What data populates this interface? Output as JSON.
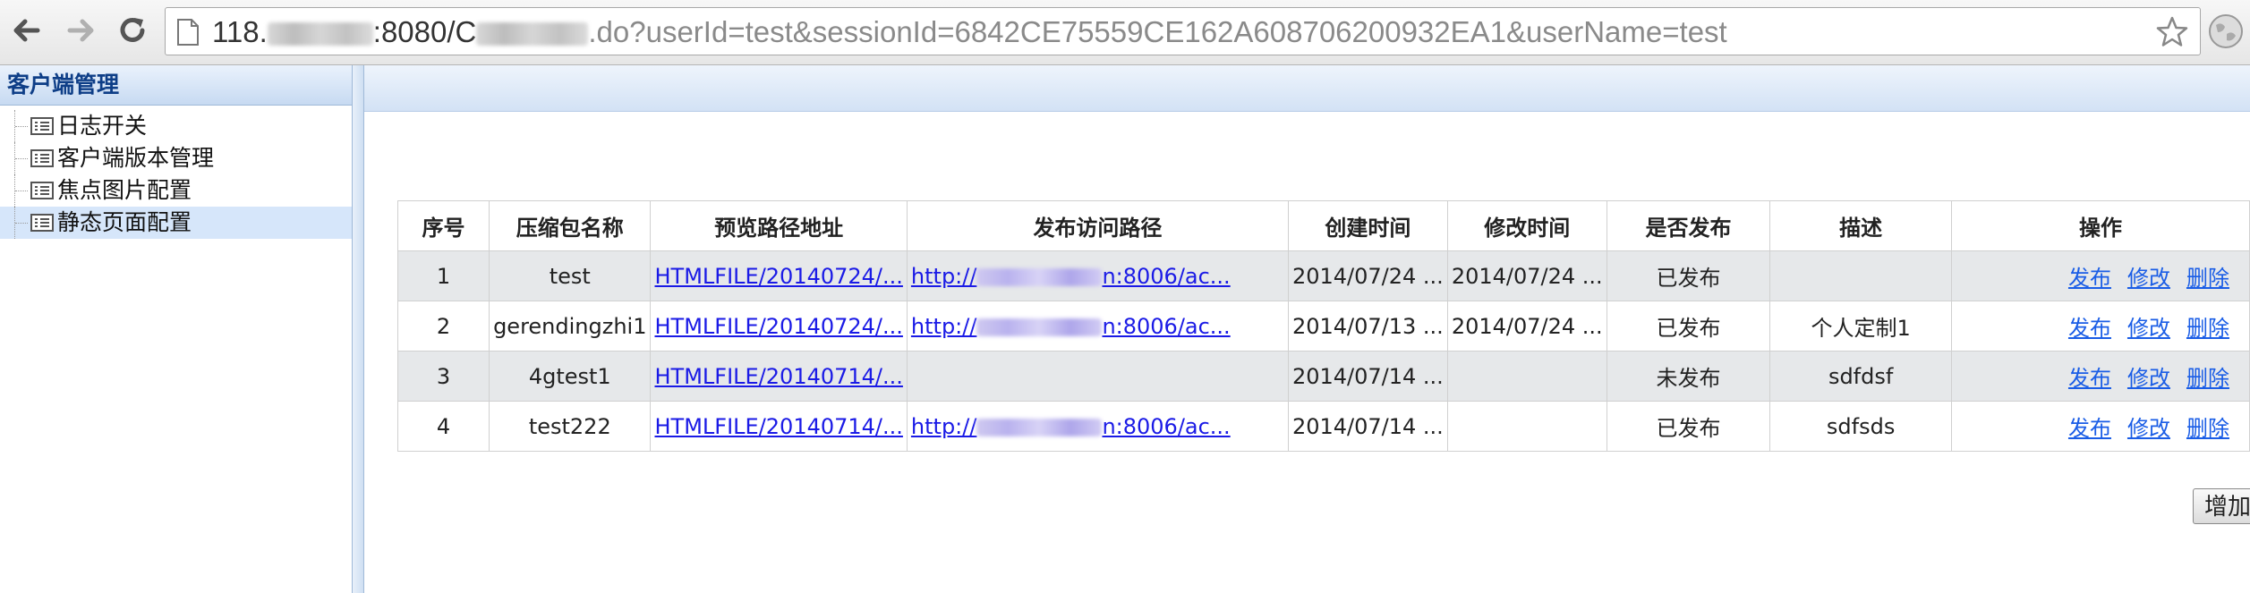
{
  "browser": {
    "url_prefix": "118.",
    "url_mid": ":8080/C",
    "url_suffix": ".do?userId=test&sessionId=6842CE75559CE162A608706200932EA1&userName=test"
  },
  "sidebar": {
    "title": "客户端管理",
    "items": [
      {
        "label": "日志开关"
      },
      {
        "label": "客户端版本管理"
      },
      {
        "label": "焦点图片配置"
      },
      {
        "label": "静态页面配置"
      }
    ]
  },
  "table": {
    "headers": [
      "序号",
      "压缩包名称",
      "预览路径地址",
      "发布访问路径",
      "创建时间",
      "修改时间",
      "是否发布",
      "描述",
      "操作"
    ],
    "rows": [
      {
        "no": "1",
        "name": "test",
        "preview": "HTMLFILE/20140724/...",
        "publish_prefix": "http://",
        "publish_suffix": "n:8006/ac...",
        "created": "2014/07/24 ...",
        "modified": "2014/07/24 ...",
        "status": "已发布",
        "desc": ""
      },
      {
        "no": "2",
        "name": "gerendingzhi1",
        "preview": "HTMLFILE/20140724/...",
        "publish_prefix": "http://",
        "publish_suffix": "n:8006/ac...",
        "created": "2014/07/13 ...",
        "modified": "2014/07/24 ...",
        "status": "已发布",
        "desc": "个人定制1"
      },
      {
        "no": "3",
        "name": "4gtest1",
        "preview": "HTMLFILE/20140714/...",
        "publish_prefix": "",
        "publish_suffix": "",
        "created": "2014/07/14 ...",
        "modified": "",
        "status": "未发布",
        "desc": "sdfdsf"
      },
      {
        "no": "4",
        "name": "test222",
        "preview": "HTMLFILE/20140714/...",
        "publish_prefix": "http://",
        "publish_suffix": "n:8006/ac...",
        "created": "2014/07/14 ...",
        "modified": "",
        "status": "已发布",
        "desc": "sdfsds"
      }
    ],
    "actions": {
      "publish": "发布",
      "edit": "修改",
      "delete": "删除"
    }
  },
  "add_button": "增加"
}
